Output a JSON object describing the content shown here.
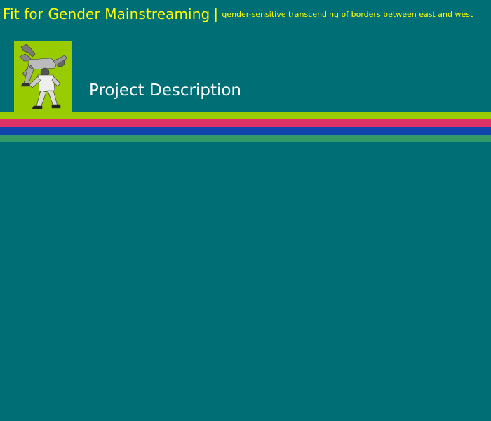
{
  "header": {
    "title": "Fit for Gender Mainstreaming",
    "separator": "|",
    "subtitle": "gender-sensitive transcending of borders between east and west"
  },
  "main": {
    "page_title": "Project Description"
  },
  "logo": {
    "icon": "dancers-photo-icon",
    "background": "#99cc00"
  },
  "colors": {
    "background": "#006e75",
    "title_text": "#ffff00",
    "page_title_text": "#ffffff",
    "stripes": [
      "#99cc00",
      "#dd3366",
      "#1144aa",
      "#339966"
    ]
  }
}
